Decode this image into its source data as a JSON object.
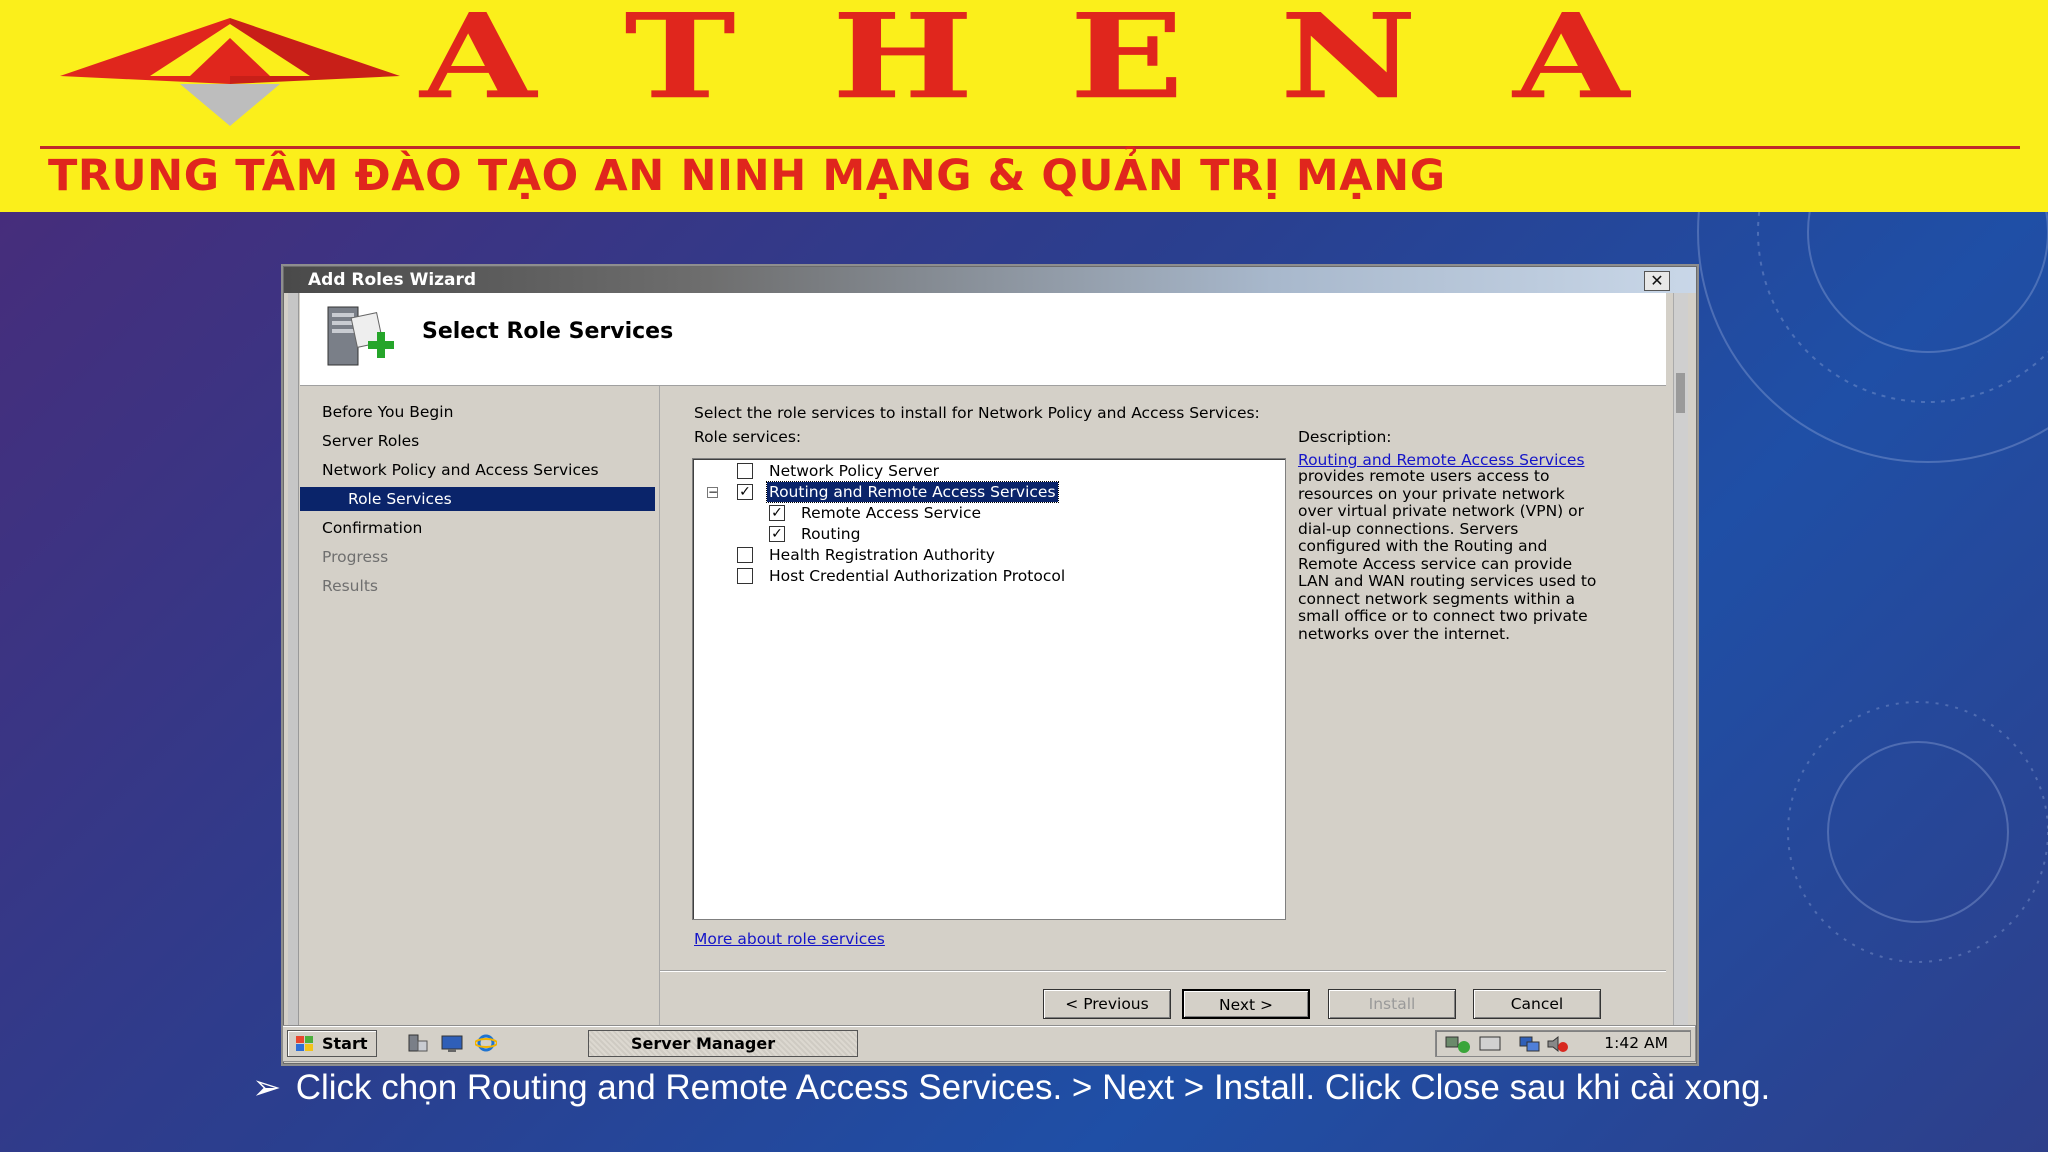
{
  "banner": {
    "brand": "ATHENA",
    "tagline": "TRUNG TÂM ĐÀO TẠO AN NINH MẠNG & QUẢN TRỊ MẠNG",
    "colors": {
      "background": "#fbef1b",
      "text": "#e0261d"
    }
  },
  "window": {
    "title": "Add Roles Wizard",
    "close_glyph": "✕",
    "page_title": "Select Role Services"
  },
  "nav": {
    "items": [
      {
        "label": "Before You Begin",
        "state": "normal"
      },
      {
        "label": "Server Roles",
        "state": "normal"
      },
      {
        "label": "Network Policy and Access Services",
        "state": "normal"
      },
      {
        "label": "Role Services",
        "state": "selected"
      },
      {
        "label": "Confirmation",
        "state": "normal"
      },
      {
        "label": "Progress",
        "state": "disabled"
      },
      {
        "label": "Results",
        "state": "disabled"
      }
    ]
  },
  "content": {
    "prompt": "Select the role services to install for Network Policy and Access Services:",
    "role_services_label": "Role services:",
    "tree": [
      {
        "label": "Network Policy Server",
        "checked": false
      },
      {
        "label": "Routing and Remote Access Services",
        "checked": true,
        "expanded": true,
        "selected": true
      },
      {
        "label": "Remote Access Service",
        "checked": true
      },
      {
        "label": "Routing",
        "checked": true
      },
      {
        "label": "Health Registration Authority",
        "checked": false
      },
      {
        "label": "Host Credential Authorization Protocol",
        "checked": false
      }
    ],
    "description_label": "Description:",
    "description_link": "Routing and Remote Access Services",
    "description_lines": [
      "provides remote users access to",
      "resources on your private network",
      "over virtual private network (VPN) or",
      "dial-up connections. Servers",
      "configured with the Routing and",
      "Remote Access service can provide",
      "LAN and WAN routing services used to",
      "connect network segments within a",
      "small office or to connect two private",
      "networks over the internet."
    ],
    "more_link": "More about role services"
  },
  "buttons": {
    "previous": "< Previous",
    "next": "Next >",
    "install": "Install",
    "cancel": "Cancel"
  },
  "taskbar": {
    "start": "Start",
    "task": "Server Manager",
    "clock": "1:42 AM"
  },
  "caption": {
    "bullet": "➢",
    "text": "Click chọn Routing and Remote Access Services. > Next > Install. Click Close sau khi cài xong."
  },
  "icons": [
    "wizard-server-icon",
    "close-icon",
    "windows-flag-icon",
    "server-manager-icon",
    "show-desktop-icon",
    "internet-explorer-icon",
    "network-icon",
    "display-icon",
    "volume-muted-icon"
  ]
}
